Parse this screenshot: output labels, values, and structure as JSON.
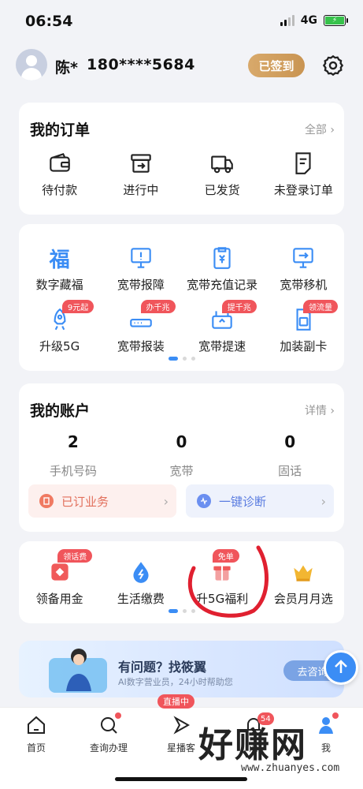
{
  "status": {
    "time": "06:54",
    "network": "4G"
  },
  "user": {
    "name": "陈*",
    "phone": "180****5684",
    "signin_label": "已签到"
  },
  "orders": {
    "title": "我的订单",
    "more": "全部 ›",
    "items": [
      {
        "label": "待付款",
        "icon": "wallet-icon"
      },
      {
        "label": "进行中",
        "icon": "box-arrow-icon"
      },
      {
        "label": "已发货",
        "icon": "truck-icon"
      },
      {
        "label": "未登录订单",
        "icon": "document-icon"
      }
    ]
  },
  "services": {
    "row1": [
      {
        "label": "数字藏福",
        "icon": "fu-icon"
      },
      {
        "label": "宽带报障",
        "icon": "monitor-alert-icon"
      },
      {
        "label": "宽带充值记录",
        "icon": "recharge-icon"
      },
      {
        "label": "宽带移机",
        "icon": "monitor-move-icon"
      }
    ],
    "row2": [
      {
        "label": "升级5G",
        "icon": "rocket-icon",
        "tag": "9元起"
      },
      {
        "label": "宽带报装",
        "icon": "router-icon",
        "tag": "办千兆"
      },
      {
        "label": "宽带提速",
        "icon": "router-speed-icon",
        "tag": "提千兆"
      },
      {
        "label": "加装副卡",
        "icon": "sim-card-icon",
        "tag": "领流量"
      }
    ]
  },
  "account": {
    "title": "我的账户",
    "more": "详情 ›",
    "stats": [
      {
        "value": "2",
        "label": "手机号码"
      },
      {
        "value": "0",
        "label": "宽带"
      },
      {
        "value": "0",
        "label": "固话"
      }
    ],
    "subscribed_label": "已订业务",
    "diagnose_label": "一键诊断"
  },
  "benefits": {
    "items": [
      {
        "label": "领备用金",
        "icon": "red-envelope-icon",
        "tag": "领话费"
      },
      {
        "label": "生活缴费",
        "icon": "water-drop-icon"
      },
      {
        "label": "升5G福利",
        "icon": "gift-icon",
        "tag": "免单"
      },
      {
        "label": "会员月月选",
        "icon": "crown-icon"
      }
    ]
  },
  "help_banner": {
    "question": "有问题？找筱翼",
    "subtitle": "AI数字营业员，24小时帮助您",
    "button": "去咨询"
  },
  "tabbar": {
    "items": [
      {
        "label": "首页",
        "icon": "home-icon"
      },
      {
        "label": "查询办理",
        "icon": "search-icon"
      },
      {
        "label": "星播客",
        "icon": "play-icon"
      },
      {
        "label": "消",
        "icon": "bell-icon"
      },
      {
        "label": "我",
        "icon": "user-icon"
      }
    ],
    "live_badge": "直播中",
    "message_count": "54"
  },
  "watermark": {
    "brand": "好赚网",
    "url": "www.zhuanyes.com"
  },
  "colors": {
    "accent": "#3b8df5",
    "gold": "#c99452",
    "red": "#f0555b"
  }
}
